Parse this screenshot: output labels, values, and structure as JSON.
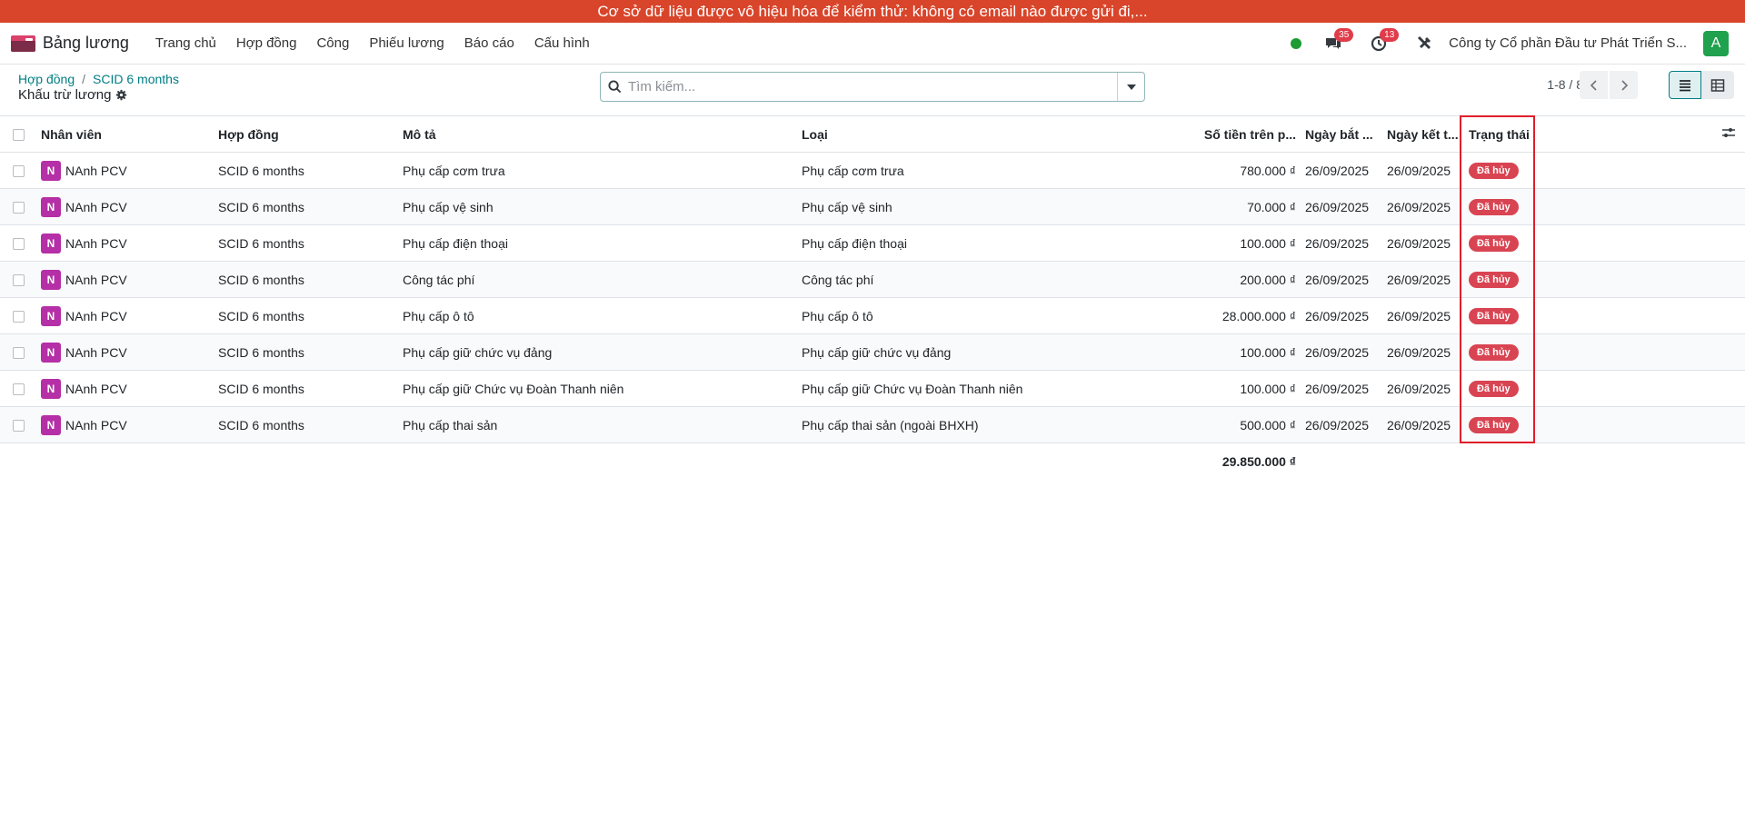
{
  "banner": {
    "text": "Cơ sở dữ liệu được vô hiệu hóa để kiểm thử: không có email nào được gửi đi,..."
  },
  "navbar": {
    "app_name": "Bảng lương",
    "menu": [
      "Trang chủ",
      "Hợp đồng",
      "Công",
      "Phiếu lương",
      "Báo cáo",
      "Cấu hình"
    ],
    "messages_count": "35",
    "activities_count": "13",
    "company": "Công ty Cổ phần Đầu tư Phát Triển S...",
    "user_initial": "A"
  },
  "control_panel": {
    "breadcrumb": [
      "Hợp đồng",
      "SCID 6 months"
    ],
    "title": "Khấu trừ lương",
    "search_placeholder": "Tìm kiếm...",
    "pager": "1-8 / 8"
  },
  "table": {
    "headers": {
      "employee": "Nhân viên",
      "contract": "Hợp đồng",
      "description": "Mô tả",
      "type": "Loại",
      "amount": "Số tiền trên p...",
      "start_date": "Ngày bắt ...",
      "end_date": "Ngày kết t...",
      "status": "Trạng thái"
    },
    "rows": [
      {
        "avatar": "N",
        "employee": "NAnh PCV",
        "contract": "SCID 6 months",
        "description": "Phụ cấp cơm trưa",
        "type": "Phụ cấp cơm trưa",
        "amount": "780.000 ₫",
        "start_date": "26/09/2025",
        "end_date": "26/09/2025",
        "status": "Đã hủy"
      },
      {
        "avatar": "N",
        "employee": "NAnh PCV",
        "contract": "SCID 6 months",
        "description": "Phụ cấp vệ sinh",
        "type": "Phụ cấp vệ sinh",
        "amount": "70.000 ₫",
        "start_date": "26/09/2025",
        "end_date": "26/09/2025",
        "status": "Đã hủy"
      },
      {
        "avatar": "N",
        "employee": "NAnh PCV",
        "contract": "SCID 6 months",
        "description": "Phụ cấp điện thoại",
        "type": "Phụ cấp điện thoại",
        "amount": "100.000 ₫",
        "start_date": "26/09/2025",
        "end_date": "26/09/2025",
        "status": "Đã hủy"
      },
      {
        "avatar": "N",
        "employee": "NAnh PCV",
        "contract": "SCID 6 months",
        "description": "Công tác phí",
        "type": "Công tác phí",
        "amount": "200.000 ₫",
        "start_date": "26/09/2025",
        "end_date": "26/09/2025",
        "status": "Đã hủy"
      },
      {
        "avatar": "N",
        "employee": "NAnh PCV",
        "contract": "SCID 6 months",
        "description": "Phụ cấp ô tô",
        "type": "Phụ cấp ô tô",
        "amount": "28.000.000 ₫",
        "start_date": "26/09/2025",
        "end_date": "26/09/2025",
        "status": "Đã hủy"
      },
      {
        "avatar": "N",
        "employee": "NAnh PCV",
        "contract": "SCID 6 months",
        "description": "Phụ cấp giữ chức vụ đảng",
        "type": "Phụ cấp giữ chức vụ đảng",
        "amount": "100.000 ₫",
        "start_date": "26/09/2025",
        "end_date": "26/09/2025",
        "status": "Đã hủy"
      },
      {
        "avatar": "N",
        "employee": "NAnh PCV",
        "contract": "SCID 6 months",
        "description": "Phụ cấp giữ Chức vụ Đoàn Thanh niên",
        "type": "Phụ cấp giữ Chức vụ Đoàn Thanh niên",
        "amount": "100.000 ₫",
        "start_date": "26/09/2025",
        "end_date": "26/09/2025",
        "status": "Đã hủy"
      },
      {
        "avatar": "N",
        "employee": "NAnh PCV",
        "contract": "SCID 6 months",
        "description": "Phụ cấp thai sản",
        "type": "Phụ cấp thai sản (ngoài BHXH)",
        "amount": "500.000 ₫",
        "start_date": "26/09/2025",
        "end_date": "26/09/2025",
        "status": "Đã hủy"
      }
    ],
    "total_amount": "29.850.000 ₫"
  },
  "colors": {
    "banner": "#d8452a",
    "accent": "#017e84",
    "status_cancelled": "#d94452",
    "avatar": "#b52fa6",
    "highlight": "#e01e2a"
  }
}
